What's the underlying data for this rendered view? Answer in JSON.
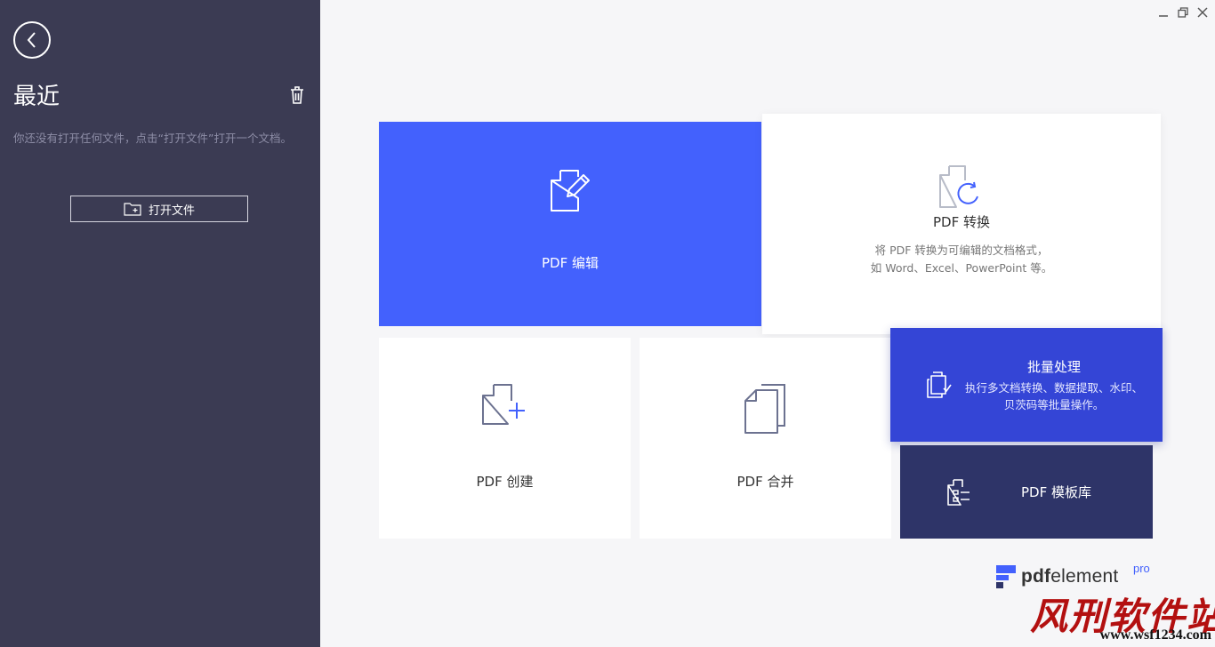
{
  "sidebar": {
    "title": "最近",
    "empty_hint": "你还没有打开任何文件，点击“打开文件”打开一个文档。",
    "open_button": "打开文件"
  },
  "cards": {
    "edit": {
      "label": "PDF 编辑",
      "icon": "edit-document-icon"
    },
    "convert": {
      "label": "PDF 转换",
      "desc_line1": "将 PDF 转换为可编辑的文档格式，",
      "desc_line2": "如 Word、Excel、PowerPoint 等。",
      "icon": "convert-document-icon"
    },
    "create": {
      "label": "PDF 创建",
      "icon": "create-document-icon"
    },
    "merge": {
      "label": "PDF 合并",
      "icon": "merge-documents-icon"
    },
    "batch": {
      "label": "批量处理",
      "desc_line1": "执行多文档转换、数据提取、水印、",
      "desc_line2": "贝茨码等批量操作。",
      "icon": "batch-process-icon"
    },
    "template": {
      "label": "PDF 模板库",
      "icon": "template-library-icon"
    }
  },
  "logo": {
    "pdf": "pdf",
    "element": "element",
    "pro": "pro"
  },
  "watermark": {
    "big": "风刑软件站",
    "url": "www.wsf1234.com"
  },
  "colors": {
    "sidebar_bg": "#3b3b53",
    "accent_blue": "#4361fd",
    "batch_blue": "#3445d6",
    "template_navy": "#2e3468"
  }
}
